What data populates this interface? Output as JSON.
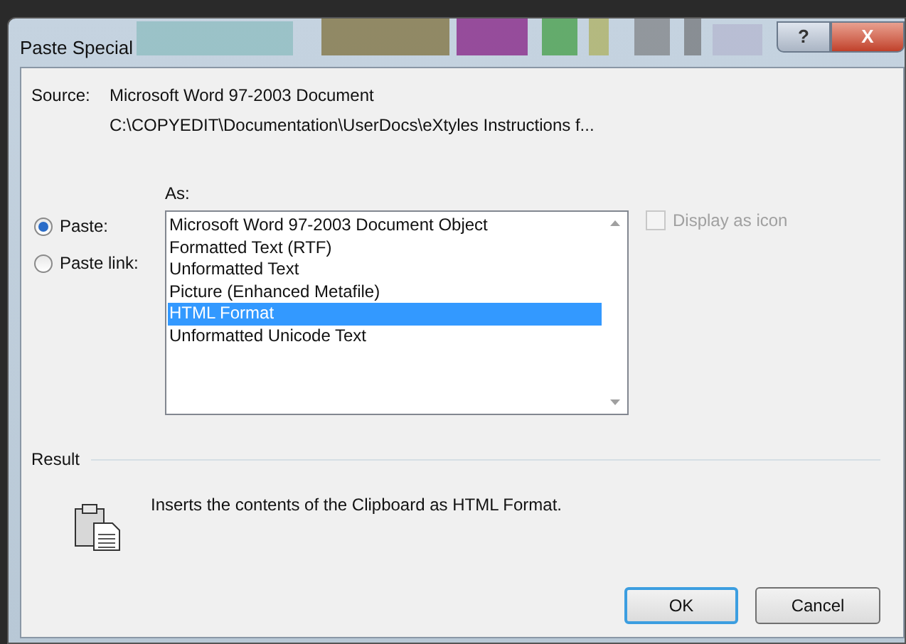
{
  "window": {
    "title": "Paste Special",
    "buttons": [
      {
        "kind": "help",
        "label": "?"
      },
      {
        "kind": "close",
        "label": "X"
      }
    ]
  },
  "source": {
    "label": "Source:",
    "value": "Microsoft Word 97-2003 Document",
    "path": "C:\\COPYEDIT\\Documentation\\UserDocs\\eXtyles Instructions f..."
  },
  "paste_options": [
    {
      "label": "Paste:",
      "selected": true
    },
    {
      "label": "Paste link:",
      "selected": false
    }
  ],
  "as": {
    "label": "As:",
    "items": [
      {
        "label": "Microsoft Word 97-2003 Document Object",
        "selected": false
      },
      {
        "label": "Formatted Text (RTF)",
        "selected": false
      },
      {
        "label": "Unformatted Text",
        "selected": false
      },
      {
        "label": "Picture (Enhanced Metafile)",
        "selected": false
      },
      {
        "label": "HTML Format",
        "selected": true
      },
      {
        "label": "Unformatted Unicode Text",
        "selected": false
      }
    ]
  },
  "display_as_icon": {
    "label": "Display as icon",
    "checked": false,
    "disabled": true
  },
  "result": {
    "label": "Result",
    "text": "Inserts the contents of the Clipboard as HTML Format."
  },
  "buttons": [
    {
      "label": "OK",
      "default": true
    },
    {
      "label": "Cancel",
      "default": false
    }
  ]
}
